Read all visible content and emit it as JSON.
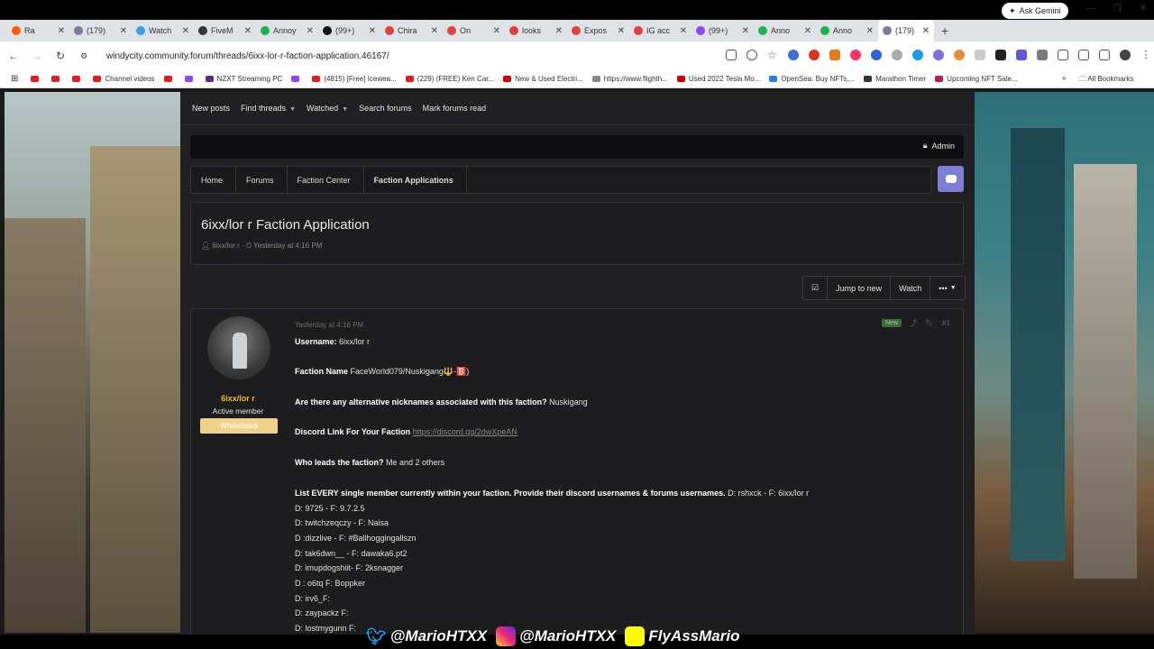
{
  "browser": {
    "tabs": [
      {
        "label": "Ra",
        "color": "#ff5a00"
      },
      {
        "label": "(179)",
        "color": "#7a7a9a"
      },
      {
        "label": "Watch",
        "color": "#3aa0e8"
      },
      {
        "label": "FiveM",
        "color": "#333333"
      },
      {
        "label": "Annoy",
        "color": "#1bb34a"
      },
      {
        "label": "(99+)",
        "color": "#111111"
      },
      {
        "label": "Chira",
        "color": "#e04040"
      },
      {
        "label": "On",
        "color": "#e04040"
      },
      {
        "label": "looks",
        "color": "#e04040"
      },
      {
        "label": "Expos",
        "color": "#e04040"
      },
      {
        "label": "IG acc",
        "color": "#e04040"
      },
      {
        "label": "(99+)",
        "color": "#9146ff"
      },
      {
        "label": "Anno",
        "color": "#1bb34a"
      },
      {
        "label": "Anno",
        "color": "#1bb34a"
      },
      {
        "label": "(179)",
        "color": "#7a7a9a"
      }
    ],
    "active_tab_index": 14,
    "ask_gemini": "Ask Gemini",
    "url": "windycity.community.forum/threads/6ixx-lor-r-faction-application.46167/",
    "bookmarks": [
      {
        "label": "",
        "color": "#e02020"
      },
      {
        "label": "",
        "color": "#e02020"
      },
      {
        "label": "",
        "color": "#e02020"
      },
      {
        "label": "Channel videos",
        "color": "#e02020"
      },
      {
        "label": "",
        "color": "#e02020"
      },
      {
        "label": "",
        "color": "#9146ff"
      },
      {
        "label": "NZXT Streaming PC",
        "color": "#5a2d82"
      },
      {
        "label": "",
        "color": "#9146ff"
      },
      {
        "label": "(4815) [Free] Icewea...",
        "color": "#e02020"
      },
      {
        "label": "(229) (FREE) Ken Car...",
        "color": "#e02020"
      },
      {
        "label": "New & Used Electri...",
        "color": "#cc0000"
      },
      {
        "label": "https://www.flighth...",
        "color": "#888888"
      },
      {
        "label": "Used 2022 Tesla Mo...",
        "color": "#cc0000"
      },
      {
        "label": "OpenSea: Buy NFTs,...",
        "color": "#2081e2"
      },
      {
        "label": "Marathon Timer",
        "color": "#333333"
      },
      {
        "label": "Upcoming NFT Sale...",
        "color": "#c2185b"
      }
    ],
    "all_bookmarks": "All Bookmarks"
  },
  "forum": {
    "subnav": [
      "New posts",
      "Find threads",
      "Watched",
      "Search forums",
      "Mark forums read"
    ],
    "admin_label": "Admin",
    "breadcrumb": [
      "Home",
      "Forums",
      "Faction Center",
      "Faction Applications"
    ],
    "thread_title": "6ixx/lor r Faction Application",
    "thread_author": "6ixx/lor r",
    "thread_time": "Yesterday at 4:16 PM",
    "actions": {
      "jump": "Jump to new",
      "watch": "Watch",
      "more": "•••"
    },
    "post": {
      "username": "6ixx/lor r",
      "user_title": "Active member",
      "user_badge": "Whitelisted",
      "date": "Yesterday at 4:16 PM",
      "new_badge": "New",
      "post_number": "#1",
      "q_username": "Username:",
      "a_username": "6ixx/lor r",
      "q_faction": "Faction Name",
      "a_faction": "FaceWorld079/Nuskigang🔱-🅱️)",
      "q_alt": "Are there any alternative nicknames associated with this faction?",
      "a_alt": "Nuskigang",
      "q_discord": "Discord Link For Your Faction",
      "a_discord": "https://discord.gg/2dwXpeAN",
      "q_leads": "Who leads the faction?",
      "a_leads": "Me and 2 others",
      "q_members": "List EVERY single member currently within your faction. Provide their discord usernames & forums usernames.",
      "members": [
        "D: rshxck - F: 6ixx/lor r",
        "D: 9725 - F: 9.7.2.5",
        "D: twitchzeqczy - F: Naisa",
        "D :dizzlive - F: #Ballhoggingallszn",
        "D: tak6dwn__ - F: dawaka6.pt2",
        "D: imupdogshiit- F: 2ksnagger",
        "D : o6tq F: Boppker",
        "D: irv6_F:",
        "D: zaypackz F:",
        "D: lostmygunn F:"
      ]
    }
  },
  "overlay": {
    "twitter": "@MarioHTXX",
    "instagram": "@MarioHTXX",
    "snapchat": "FlyAssMario"
  }
}
